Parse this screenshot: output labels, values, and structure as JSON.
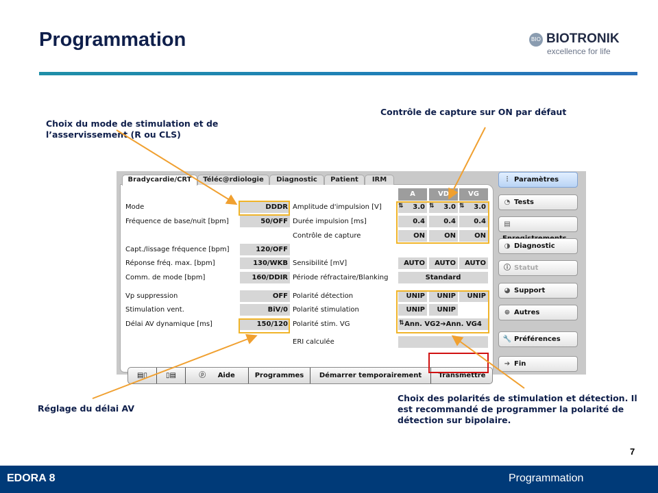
{
  "slide": {
    "title": "Programmation",
    "page_number": "7",
    "footer_left": "EDORA 8",
    "footer_right": "Programmation"
  },
  "logo": {
    "mark": "BIO",
    "name": "BIOTRONIK",
    "tagline": "excellence for life"
  },
  "annotations": {
    "mode": "Choix du mode de stimulation et de l’asservissement (R ou CLS)",
    "capture": "Contrôle de capture sur ON par défaut",
    "av_delay": "Réglage du délai AV",
    "polarity": "Choix des polarités de stimulation et détection. Il est recommandé de programmer la polarité de détection sur bipolaire."
  },
  "colors": {
    "highlight": "#f0b429",
    "transmit_box": "#d01010",
    "footer": "#003a78"
  },
  "tabs": [
    {
      "label": "Bradycardie/CRT",
      "active": true
    },
    {
      "label": "Téléc@rdiologie"
    },
    {
      "label": "Diagnostic"
    },
    {
      "label": "Patient"
    },
    {
      "label": "IRM"
    }
  ],
  "left_params": [
    {
      "label": "Mode",
      "value": "DDDR"
    },
    {
      "label": "Fréquence de base/nuit [bpm]",
      "value": "50/OFF"
    },
    {
      "label": "Capt./lissage fréquence [bpm]",
      "value": "120/OFF"
    },
    {
      "label": "Réponse fréq. max. [bpm]",
      "value": "130/WKB"
    },
    {
      "label": "Comm. de mode [bpm]",
      "value": "160/DDIR"
    },
    {
      "label": "Vp suppression",
      "value": "OFF"
    },
    {
      "label": "Stimulation vent.",
      "value": "BiV/0"
    },
    {
      "label": "Délai AV dynamique [ms]",
      "value": "150/120"
    }
  ],
  "chamber_headers": [
    "A",
    "VD",
    "VG"
  ],
  "right_params": [
    {
      "label": "Amplitude d'impulsion  [V]",
      "values": [
        "3.0",
        "3.0",
        "3.0"
      ],
      "stepper": true
    },
    {
      "label": "Durée impulsion [ms]",
      "values": [
        "0.4",
        "0.4",
        "0.4"
      ]
    },
    {
      "label": "Contrôle de capture",
      "values": [
        "ON",
        "ON",
        "ON"
      ]
    },
    {
      "label": "Sensibilité [mV]",
      "values": [
        "AUTO",
        "AUTO",
        "AUTO"
      ]
    },
    {
      "label": "Période réfractaire/Blanking",
      "span": "Standard"
    },
    {
      "label": "Polarité détection",
      "values": [
        "UNIP",
        "UNIP",
        "UNIP"
      ]
    },
    {
      "label": "Polarité stimulation",
      "values": [
        "UNIP",
        "UNIP"
      ]
    },
    {
      "label": "Polarité stim. VG",
      "span": "Ann. VG2➔Ann. VG4",
      "stepper": true
    },
    {
      "label": "ERI calculée",
      "span": ""
    }
  ],
  "toolbar": {
    "help": "Aide",
    "programs": "Programmes",
    "start_temp": "Démarrer temporairement",
    "transmit": "Transmettre"
  },
  "nav": [
    {
      "label": "Paramètres",
      "icon": "sliders-icon",
      "glyph": "⫶",
      "active": true
    },
    {
      "label": "Tests",
      "icon": "tests-icon",
      "glyph": "◔"
    },
    {
      "label": "Enregistrements",
      "icon": "ecg-icon",
      "glyph": "▤"
    },
    {
      "label": "Diagnostic",
      "icon": "diagnostic-icon",
      "glyph": "◑"
    },
    {
      "label": "Statut",
      "icon": "info-icon",
      "glyph": "ⓘ",
      "disabled": true
    },
    {
      "label": "Support",
      "icon": "support-icon",
      "glyph": "◕"
    },
    {
      "label": "Autres",
      "icon": "plus-icon",
      "glyph": "⊕"
    },
    {
      "label": "Préférences",
      "icon": "wrench-icon",
      "glyph": "🔧"
    },
    {
      "label": "Fin",
      "icon": "exit-icon",
      "glyph": "➔"
    }
  ]
}
